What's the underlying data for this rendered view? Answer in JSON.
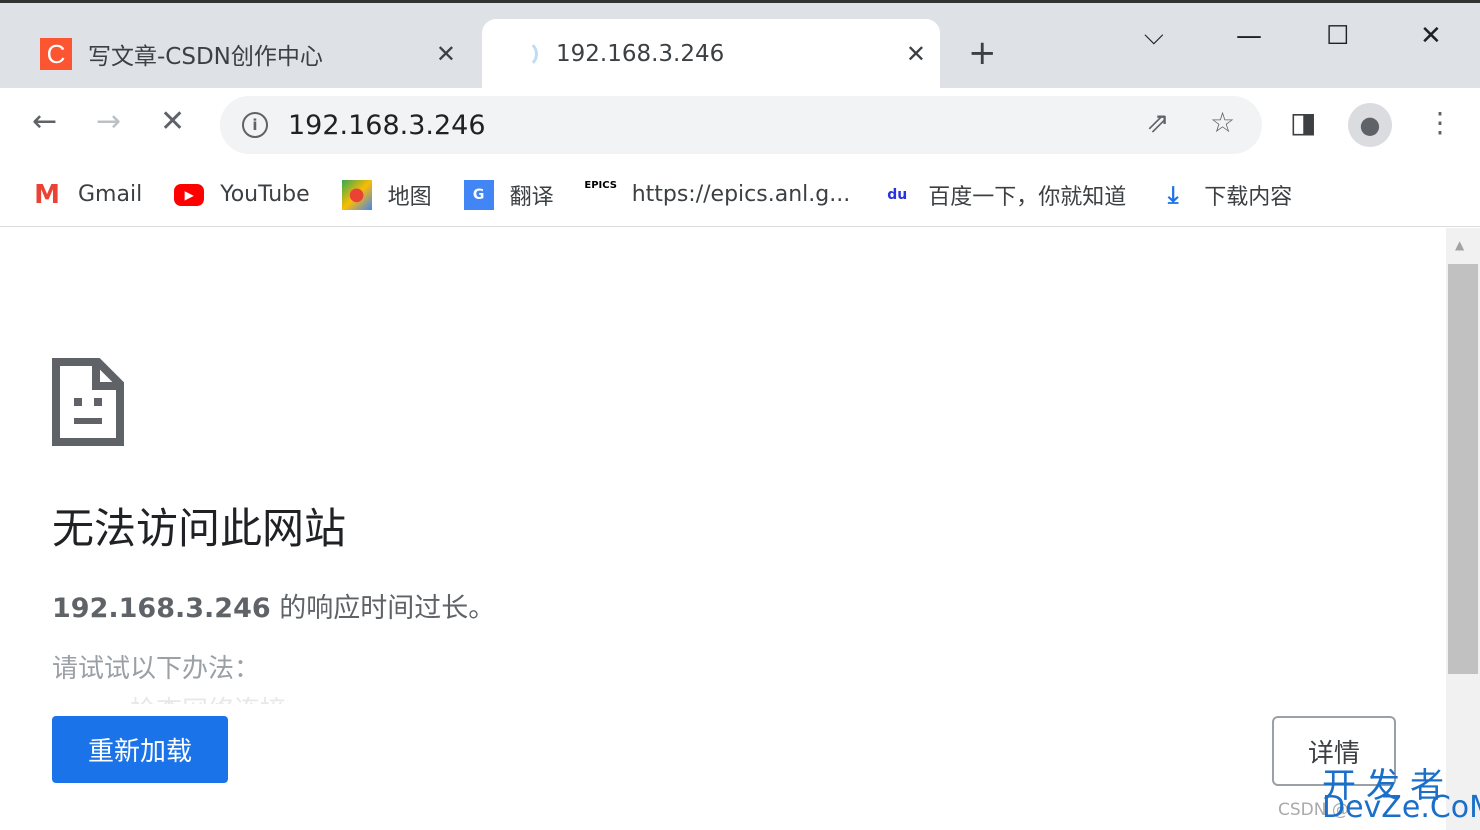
{
  "tabs": [
    {
      "title": "写文章-CSDN创作中心",
      "favicon": "C",
      "active": false
    },
    {
      "title": "192.168.3.246",
      "active": true,
      "loading": true
    }
  ],
  "omnibox": {
    "url": "192.168.3.246"
  },
  "bookmarks": [
    {
      "label": "Gmail",
      "icon": "gmail-icon"
    },
    {
      "label": "YouTube",
      "icon": "youtube-icon"
    },
    {
      "label": "地图",
      "icon": "maps-icon"
    },
    {
      "label": "翻译",
      "icon": "translate-icon"
    },
    {
      "label": "https://epics.anl.g...",
      "icon": "epics-icon",
      "icon_text": "EPICS"
    },
    {
      "label": "百度一下，你就知道",
      "icon": "baidu-icon",
      "icon_text": "du"
    },
    {
      "label": "下载内容",
      "icon": "download-icon"
    }
  ],
  "error": {
    "title": "无法访问此网站",
    "host": "192.168.3.246",
    "message": " 的响应时间过长。",
    "suggest": "请试试以下办法：",
    "suggest_item": "检查网络连接",
    "reload": "重新加载",
    "details": "详情"
  },
  "watermark": {
    "line1": "开发者",
    "line2": "DevZe.CoM",
    "csdn": "CSDN @"
  },
  "colors": {
    "accent": "#1a73e8",
    "csdn": "#fc5531"
  }
}
